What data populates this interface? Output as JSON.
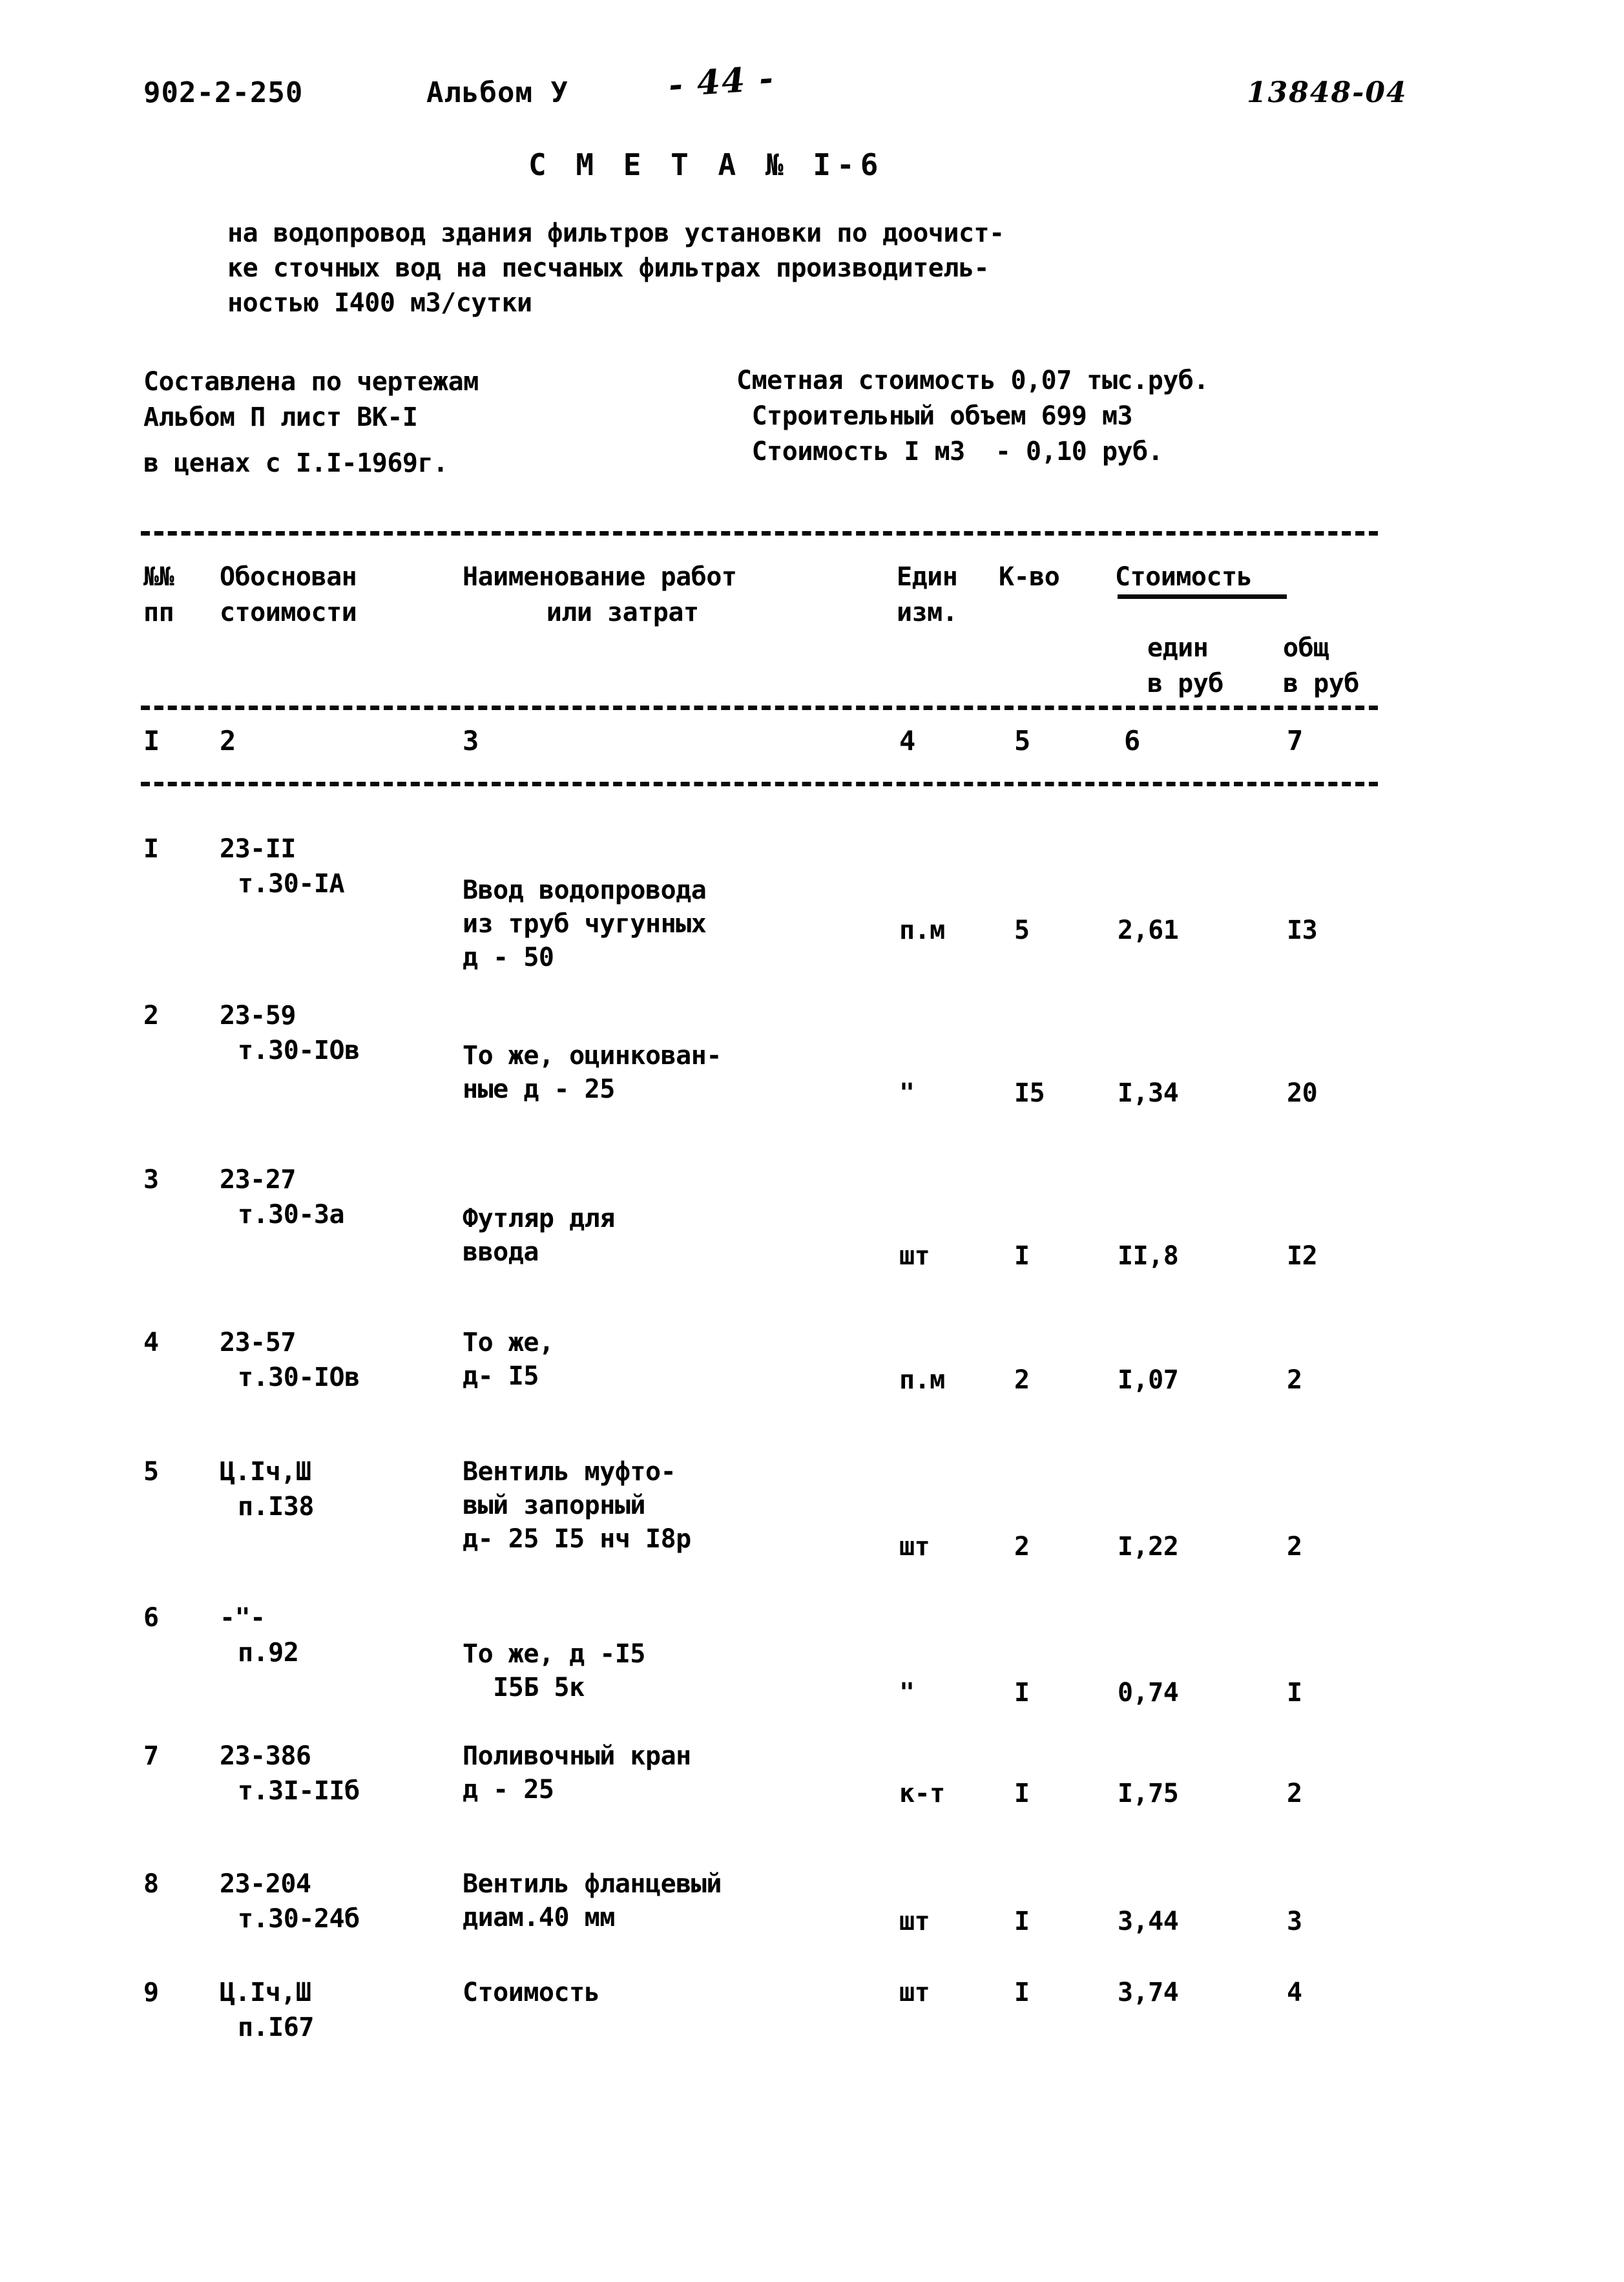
{
  "header": {
    "project_code": "902-2-250",
    "album": "Альбом У",
    "page_number": "- 44 -",
    "doc_number": "13848-04"
  },
  "title": "С М Е Т А № I-6",
  "subtitle": "на водопровод здания фильтров установки по доочист-\nке сточных вод на песчаных фильтрах производитель-\nностью I400 м3/сутки",
  "meta_left": "Составлена по чертежам\nАльбом П лист ВК-I",
  "meta_left_prices": "в ценах с I.I-1969г.",
  "meta_right": "Сметная стоимость 0,07 тыс.руб.\n Строительный объем 699 м3\n Стоимость I м3  - 0,10 руб.",
  "table": {
    "headers": {
      "num": "№№\nпп",
      "basis": "Обоснован\nстоимости",
      "name": "Наименование работ\n   или затрат",
      "unit": "Един\nизм.",
      "qty": "К-во",
      "cost": "Стоимость",
      "cost_unit": "един\nв руб",
      "cost_total": "общ\nв руб"
    },
    "column_numbers": [
      "I",
      "2",
      "3",
      "4",
      "5",
      "6",
      "7"
    ],
    "rows": [
      {
        "num": "I",
        "basis_line1": "23-II",
        "basis_line2": "т.30-IA",
        "name": "Ввод водопровода\nиз труб чугунных\nд - 50",
        "unit": "п.м",
        "qty": "5",
        "unit_price": "2,61",
        "total": "I3"
      },
      {
        "num": "2",
        "basis_line1": "23-59",
        "basis_line2": "т.30-IOв",
        "name": "То же, оцинкован-\nные д - 25",
        "unit": "\"",
        "qty": "I5",
        "unit_price": "I,34",
        "total": "20"
      },
      {
        "num": "3",
        "basis_line1": "23-27",
        "basis_line2": "т.30-3а",
        "name": "Футляр для\nввода",
        "unit": "шт",
        "qty": "I",
        "unit_price": "II,8",
        "total": "I2"
      },
      {
        "num": "4",
        "basis_line1": "23-57",
        "basis_line2": "т.30-IOв",
        "name": "То же,\nд- I5",
        "unit": "п.м",
        "qty": "2",
        "unit_price": "I,07",
        "total": "2"
      },
      {
        "num": "5",
        "basis_line1": "Ц.Iч,Ш",
        "basis_line2": "п.I38",
        "name": "Вентиль муфто-\nвый запорный\nд- 25 I5 нч I8р",
        "unit": "шт",
        "qty": "2",
        "unit_price": "I,22",
        "total": "2"
      },
      {
        "num": "6",
        "basis_line1": "-\"-",
        "basis_line2": "п.92",
        "name": "То же, д -I5\n  I5Б 5к",
        "unit": "\"",
        "qty": "I",
        "unit_price": "0,74",
        "total": "I"
      },
      {
        "num": "7",
        "basis_line1": "23-386",
        "basis_line2": "т.3I-IIб",
        "name": "Поливочный кран\nд - 25",
        "unit": "к-т",
        "qty": "I",
        "unit_price": "I,75",
        "total": "2"
      },
      {
        "num": "8",
        "basis_line1": "23-204",
        "basis_line2": "т.30-24б",
        "name": "Вентиль фланцевый\nдиам.40 мм",
        "unit": "шт",
        "qty": "I",
        "unit_price": "3,44",
        "total": "3"
      },
      {
        "num": "9",
        "basis_line1": "Ц.Iч,Ш",
        "basis_line2": "п.I67",
        "name": "Стоимость",
        "unit": "шт",
        "qty": "I",
        "unit_price": "3,74",
        "total": "4"
      }
    ]
  }
}
